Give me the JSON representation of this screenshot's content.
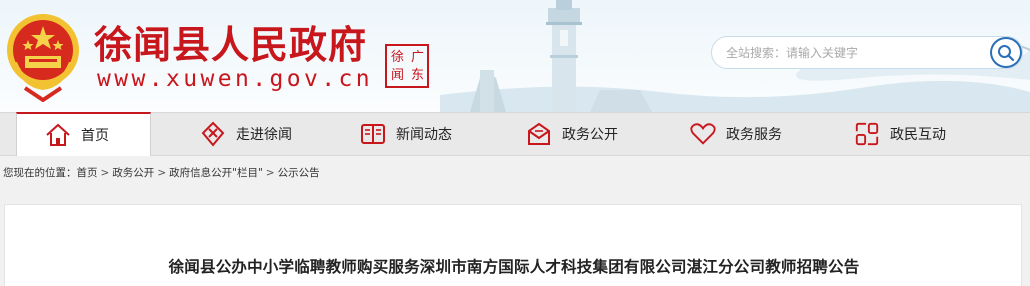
{
  "header": {
    "site_name": "徐闻县人民政府",
    "site_url": "www.xuwen.gov.cn",
    "seal_chars": [
      "徐",
      "闻",
      "广",
      "东"
    ],
    "brand_color": "#c8161d"
  },
  "search": {
    "placeholder": "全站搜索：请输入关键字",
    "icon": "search-icon"
  },
  "nav": {
    "items": [
      {
        "label": "首页",
        "icon": "home-icon",
        "active": true
      },
      {
        "label": "走进徐闻",
        "icon": "compass-icon",
        "active": false
      },
      {
        "label": "新闻动态",
        "icon": "newspaper-icon",
        "active": false
      },
      {
        "label": "政务公开",
        "icon": "mail-icon",
        "active": false
      },
      {
        "label": "政务服务",
        "icon": "heart-icon",
        "active": false
      },
      {
        "label": "政民互动",
        "icon": "interaction-icon",
        "active": false
      }
    ]
  },
  "breadcrumb": {
    "prefix": "您现在的位置：",
    "items": [
      "首页",
      "政务公开",
      "政府信息公开\"栏目\"",
      "公示公告"
    ],
    "separator": ">"
  },
  "article": {
    "title": "徐闻县公办中小学临聘教师购买服务深圳市南方国际人才科技集团有限公司湛江分公司教师招聘公告"
  }
}
